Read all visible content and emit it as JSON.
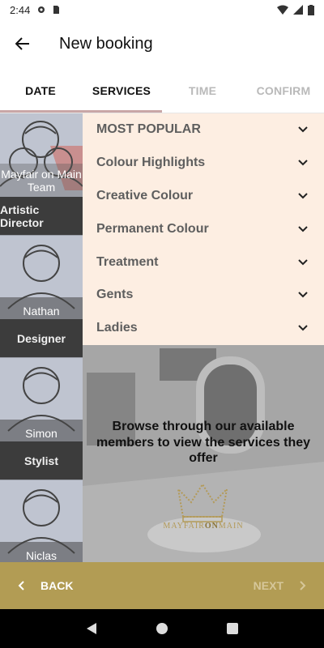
{
  "status_bar": {
    "time": "2:44"
  },
  "app_bar": {
    "title": "New booking"
  },
  "tabs": [
    {
      "label": "DATE",
      "active": true
    },
    {
      "label": "SERVICES",
      "active": true
    },
    {
      "label": "TIME",
      "active": false
    },
    {
      "label": "CONFIRM",
      "active": false
    }
  ],
  "staff": [
    {
      "name": "Mayfair on Main Team",
      "role": "Artistic Director"
    },
    {
      "name": "Nathan",
      "role": "Designer"
    },
    {
      "name": "Simon",
      "role": "Stylist"
    },
    {
      "name": "Niclas",
      "role": ""
    }
  ],
  "categories": [
    "MOST POPULAR",
    "Colour Highlights",
    "Creative Colour",
    "Permanent Colour",
    "Treatment",
    "Gents",
    "Ladies"
  ],
  "browse_text": "Browse through our available members to view the services they offer",
  "logo": {
    "part1": "MAYFAIR",
    "part2": "ON",
    "part3": "MAIN"
  },
  "actions": {
    "back_label": "BACK",
    "next_label": "NEXT"
  },
  "colors": {
    "gold": "#b29c54",
    "peach": "#fdeee2",
    "staff_bg": "#bfc4d0"
  }
}
